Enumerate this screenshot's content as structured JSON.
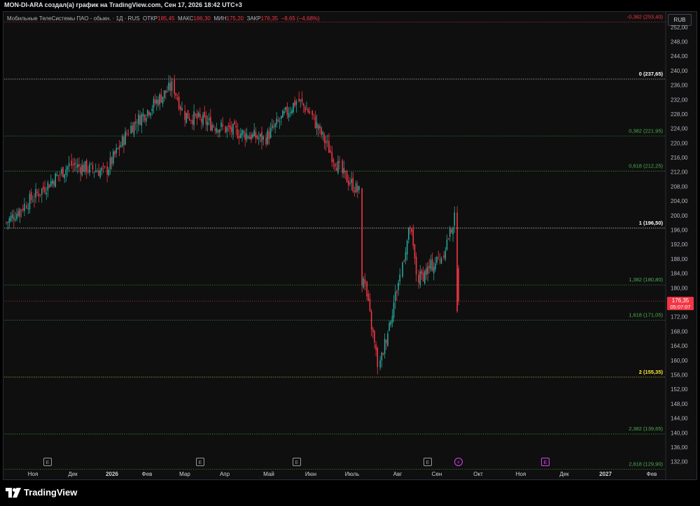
{
  "header": {
    "text": "MON-DI-ARA создал(а) график на TradingView.com, Сен 17, 2026 18:42 UTC+3"
  },
  "legend": {
    "symbol": "Мобильные ТелеСистемы ПАО - обыкн. · 1Д · RUS",
    "open_label": "ОТКР",
    "open": "185,45",
    "high_label": "МАКС",
    "high": "186,30",
    "low_label": "МИН",
    "low": "175,20",
    "close_label": "ЗАКР",
    "close": "176,35",
    "change": "−8,65 (−4,68%)"
  },
  "currency": "RUB",
  "price_tag": {
    "price": "176,35",
    "timer": "05:07:07",
    "value": 176.35
  },
  "brand": "TradingView",
  "colors": {
    "up": "#26a69a",
    "down": "#f23645",
    "background": "#0f0f0f",
    "fib_green": "#4caf50",
    "fib_white": "#ffffff",
    "fib_yellow": "#ffeb3b",
    "fib_red": "#f23645"
  },
  "chart_data": {
    "type": "candlestick",
    "ylim": [
      130,
      254
    ],
    "y_ticks": [
      "252,00",
      "248,00",
      "244,00",
      "240,00",
      "236,00",
      "232,00",
      "228,00",
      "224,00",
      "220,00",
      "216,00",
      "212,00",
      "208,00",
      "204,00",
      "200,00",
      "196,00",
      "192,00",
      "188,00",
      "184,00",
      "180,00",
      "176,00",
      "172,00",
      "168,00",
      "164,00",
      "160,00",
      "156,00",
      "152,00",
      "148,00",
      "144,00",
      "140,00",
      "136,00",
      "132,00"
    ],
    "x_labels": [
      {
        "label": "Ноя",
        "bold": false
      },
      {
        "label": "Дек",
        "bold": false
      },
      {
        "label": "2026",
        "bold": true
      },
      {
        "label": "Фев",
        "bold": false
      },
      {
        "label": "Мар",
        "bold": false
      },
      {
        "label": "Апр",
        "bold": false
      },
      {
        "label": "Май",
        "bold": false
      },
      {
        "label": "Июн",
        "bold": false
      },
      {
        "label": "Июль",
        "bold": false
      },
      {
        "label": "Авг",
        "bold": false
      },
      {
        "label": "Сен",
        "bold": false
      },
      {
        "label": "Окт",
        "bold": false
      },
      {
        "label": "Ноя",
        "bold": false
      },
      {
        "label": "Дек",
        "bold": false
      },
      {
        "label": "2027",
        "bold": true
      },
      {
        "label": "Фев",
        "bold": false
      }
    ],
    "events": [
      {
        "label": "E",
        "kind": "earnings",
        "month": "Ноя"
      },
      {
        "label": "E",
        "kind": "earnings",
        "month": "Мар"
      },
      {
        "label": "E",
        "kind": "earnings",
        "month": "Июн"
      },
      {
        "label": "E",
        "kind": "earnings",
        "month": "Сен"
      },
      {
        "label": "⚡",
        "kind": "dividend",
        "month": "Сен"
      },
      {
        "label": "E",
        "kind": "future-earnings",
        "month": "Дек"
      }
    ],
    "fib_levels": [
      {
        "ratio": "-0,382",
        "price": 253.4,
        "text": "-0,382 (253,40)",
        "color": "#f23645",
        "bold": false
      },
      {
        "ratio": "0",
        "price": 237.65,
        "text": "0 (237,65)",
        "color": "#ffffff",
        "bold": true
      },
      {
        "ratio": "0,382",
        "price": 221.95,
        "text": "0,382 (221,95)",
        "color": "#4caf50",
        "bold": false
      },
      {
        "ratio": "0,618",
        "price": 212.25,
        "text": "0,618 (212,25)",
        "color": "#4caf50",
        "bold": false
      },
      {
        "ratio": "1",
        "price": 196.5,
        "text": "1 (196,50)",
        "color": "#ffffff",
        "bold": true
      },
      {
        "ratio": "1,382",
        "price": 180.8,
        "text": "1,382 (180,80)",
        "color": "#4caf50",
        "bold": false
      },
      {
        "ratio": "1,618",
        "price": 171.05,
        "text": "1,618 (171,05)",
        "color": "#4caf50",
        "bold": false
      },
      {
        "ratio": "2",
        "price": 155.35,
        "text": "2 (155,35)",
        "color": "#ffeb3b",
        "bold": true
      },
      {
        "ratio": "2,382",
        "price": 139.65,
        "text": "2,382 (139,65)",
        "color": "#4caf50",
        "bold": false
      },
      {
        "ratio": "2,618",
        "price": 129.9,
        "text": "2,618 (129,90)",
        "color": "#4caf50",
        "bold": false
      }
    ],
    "series_anchors": [
      {
        "month": "Окт '25 (start)",
        "close": 198
      },
      {
        "month": "Ноя",
        "close": 203
      },
      {
        "month": "Дек",
        "close": 214
      },
      {
        "month": "2026",
        "close": 212
      },
      {
        "month": "Фев",
        "close": 224
      },
      {
        "month": "Мар",
        "close": 236
      },
      {
        "month": "Мар (mid)",
        "close": 228
      },
      {
        "month": "Апр",
        "close": 224
      },
      {
        "month": "Май",
        "close": 221
      },
      {
        "month": "Май (late)",
        "close": 232
      },
      {
        "month": "Июн",
        "close": 228
      },
      {
        "month": "Июн (late)",
        "close": 212
      },
      {
        "month": "Июль",
        "close": 206
      },
      {
        "month": "Июль (gap)",
        "close": 180
      },
      {
        "month": "Июль (low)",
        "close": 157
      },
      {
        "month": "Авг",
        "close": 185
      },
      {
        "month": "Авг (mid)",
        "close": 197
      },
      {
        "month": "Авг (late)",
        "close": 182
      },
      {
        "month": "Сен",
        "close": 189
      },
      {
        "month": "Сен (high)",
        "close": 200
      },
      {
        "month": "Сен (last)",
        "close": 176.35
      }
    ]
  }
}
